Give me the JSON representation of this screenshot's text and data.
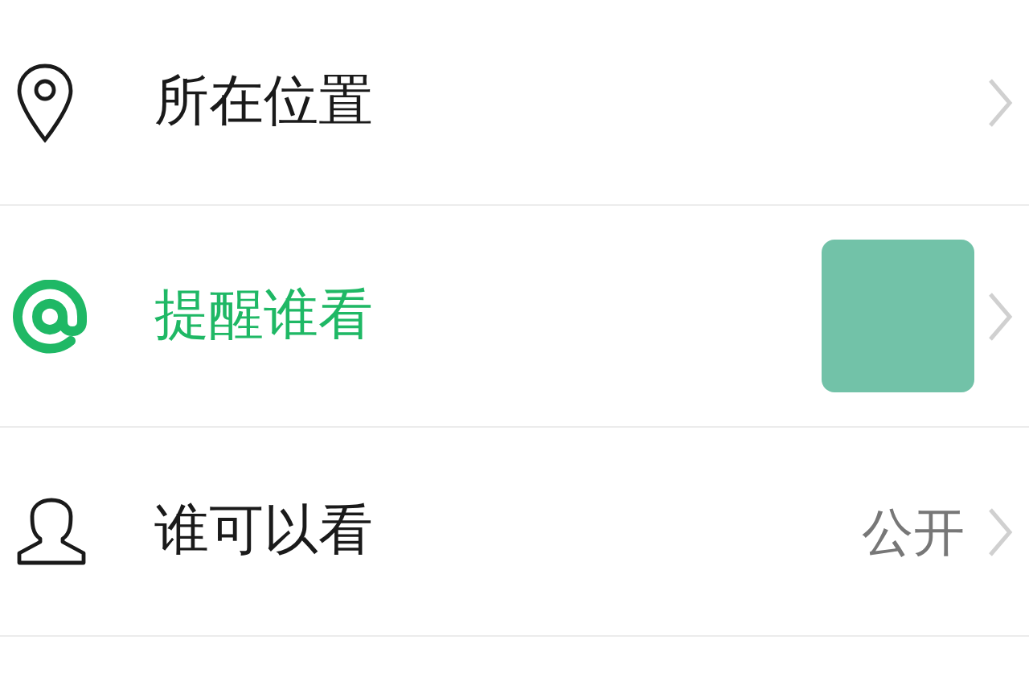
{
  "rows": [
    {
      "kind": "location",
      "label": "所在位置",
      "active": false
    },
    {
      "kind": "mention",
      "label": "提醒谁看",
      "active": true
    },
    {
      "kind": "visibility",
      "label": "谁可以看",
      "active": false,
      "value": "公开"
    }
  ]
}
